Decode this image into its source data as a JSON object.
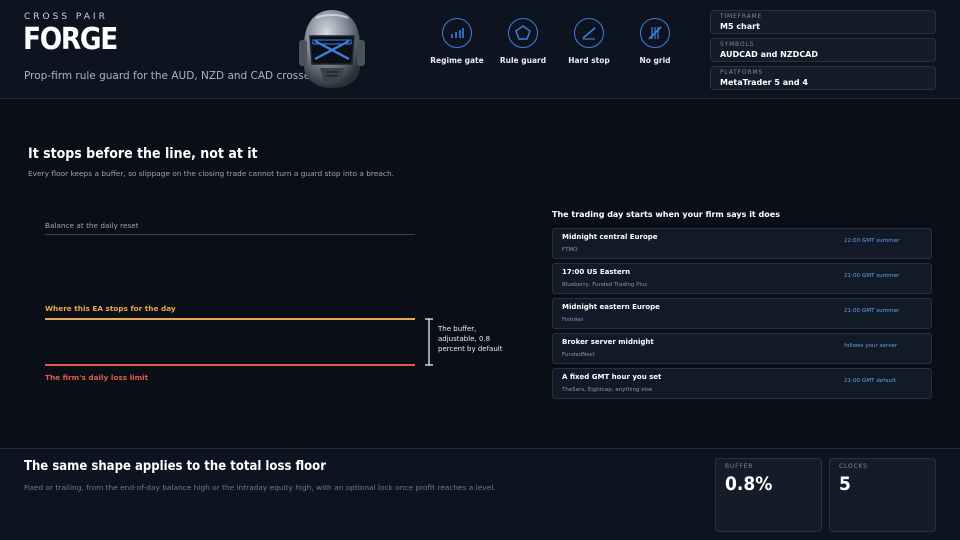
{
  "header": {
    "eyebrow": "CROSS PAIR",
    "brand": "FORGE",
    "tagline": "Prop-firm rule guard for the AUD, NZD and CAD crosses",
    "features": [
      {
        "label": "Regime gate",
        "icon": "bar-chart-icon"
      },
      {
        "label": "Rule guard",
        "icon": "pentagon-icon"
      },
      {
        "label": "Hard stop",
        "icon": "slash-stop-icon"
      },
      {
        "label": "No grid",
        "icon": "no-grid-icon"
      }
    ],
    "specs": [
      {
        "key": "TIMEFRAME",
        "value": "M5 chart"
      },
      {
        "key": "SYMBOLS",
        "value": "AUDCAD and NZDCAD"
      },
      {
        "key": "PLATFORMS",
        "value": "MetaTrader 5 and 4"
      }
    ]
  },
  "floor": {
    "title": "It stops before the line, not at it",
    "subtitle": "Every floor keeps a buffer, so slippage on the closing trade cannot turn a guard stop into a breach.",
    "balance_label": "Balance at the daily reset",
    "ea_label": "Where this EA stops for the day",
    "limit_label": "The firm's daily loss limit",
    "buffer_note": "The buffer, adjustable, 0.8 percent by default",
    "colors": {
      "ea": "#e8a94a",
      "limit": "#e0594f",
      "balance": "#3a4454"
    }
  },
  "timezones": {
    "title": "The trading day starts when your firm says it does",
    "rows": [
      {
        "title": "Midnight central Europe",
        "firms": "FTMO",
        "gmt": "22:00 GMT summer"
      },
      {
        "title": "17:00 US Eastern",
        "firms": "Blueberry, Funded Trading Plus",
        "gmt": "21:00 GMT summer"
      },
      {
        "title": "Midnight eastern Europe",
        "firms": "Fintokei",
        "gmt": "21:00 GMT summer"
      },
      {
        "title": "Broker server midnight",
        "firms": "FundedNext",
        "gmt": "follows your server"
      },
      {
        "title": "A fixed GMT hour you set",
        "firms": "The5ers, Eightcap, anything else",
        "gmt": "21:00 GMT default"
      }
    ]
  },
  "footer": {
    "title": "The same shape applies to the total loss floor",
    "subtitle": "Fixed or trailing, from the end-of-day balance high or the intraday equity high, with an optional lock once profit reaches a level.",
    "stats": [
      {
        "key": "BUFFER",
        "value": "0.8%"
      },
      {
        "key": "CLOCKS",
        "value": "5"
      }
    ]
  },
  "accent": "#3f7fe0"
}
